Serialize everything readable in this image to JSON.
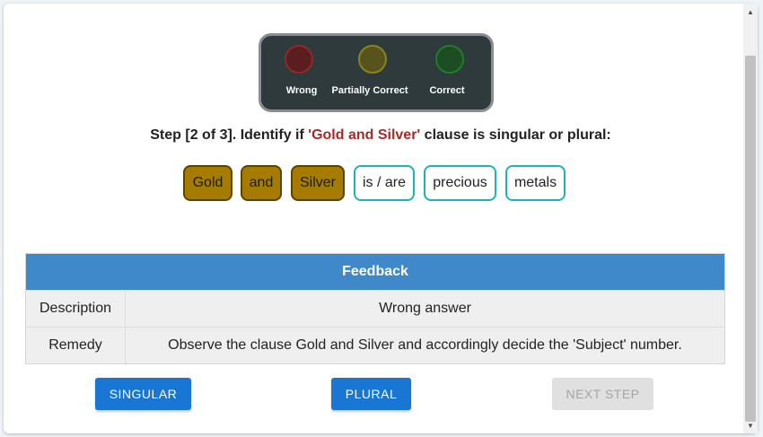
{
  "indicators": [
    {
      "label": "Wrong",
      "state": "off",
      "color": "#8e2a2a",
      "icon": "red-light-icon"
    },
    {
      "label": "Partially Correct",
      "state": "off",
      "color": "#8b8418",
      "icon": "yellow-light-icon"
    },
    {
      "label": "Correct",
      "state": "off",
      "color": "#1f7d2a",
      "icon": "green-light-icon"
    }
  ],
  "question": {
    "prefix": "Step [2 of 3]. Identify if ",
    "highlight": "'Gold and Silver'",
    "suffix": " clause is singular or plural:"
  },
  "chips": [
    {
      "text": "Gold",
      "selected": true
    },
    {
      "text": "and",
      "selected": true
    },
    {
      "text": "Silver",
      "selected": true
    },
    {
      "text": "is / are",
      "selected": false
    },
    {
      "text": "precious",
      "selected": false
    },
    {
      "text": "metals",
      "selected": false
    }
  ],
  "feedback": {
    "title": "Feedback",
    "rows": [
      {
        "key": "Description",
        "value": "Wrong answer"
      },
      {
        "key": "Remedy",
        "value": "Observe the clause Gold and Silver and accordingly decide the 'Subject' number."
      }
    ]
  },
  "buttons": {
    "singular": "SINGULAR",
    "plural": "PLURAL",
    "next": "NEXT STEP"
  },
  "colors": {
    "accent": "#1976d2",
    "header": "#3f88c9",
    "highlight": "#a52a2a",
    "chip_selected": "#a67c00",
    "chip_border": "#22b2b2"
  }
}
